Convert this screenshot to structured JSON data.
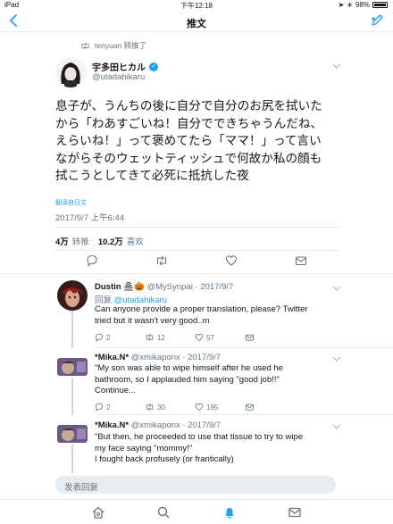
{
  "status_bar": {
    "carrier": "iPad",
    "time": "下午12:18",
    "battery": "98%"
  },
  "nav": {
    "title": "推文"
  },
  "retweet": {
    "text": "tenyuan 转推了"
  },
  "tweet": {
    "author_name": "宇多田ヒカル",
    "author_handle": "@utadahikaru",
    "lines": [
      "息子が、うんちの後に自分で自分のお尻を拭いた",
      "から「わあすごいね！自分でできちゃうんだね、",
      "えらいね！」って褒めてたら「ママ！」って言い",
      "ながらそのウェットティッシュで何故か私の顔も",
      "拭こうとしてきて必死に抵抗した夜"
    ],
    "translate_label": "翻译自日文",
    "timestamp": "2017/9/7 上午6:44",
    "retweets_count": "4万",
    "retweets_label": "转推",
    "likes_count": "10.2万",
    "likes_label": "喜欢"
  },
  "replies": [
    {
      "name": "Dustin",
      "handle_date": "@MySynpai · 2017/9/7",
      "reply_to_prefix": "回复",
      "reply_to": "@utadahikaru",
      "lines": [
        "Can anyone provide a proper translation, please? Twitter",
        "tried but it wasn't very good..m"
      ],
      "replies": "2",
      "retweets": "12",
      "likes": "57"
    },
    {
      "name": "*Mika.N*",
      "handle_date": "@xmikaponx · 2017/9/7",
      "lines": [
        "\"My son was able to wipe himself after he used he",
        "bathroom, so I applauded him saying \"good job!!\"",
        "Continue..."
      ],
      "replies": "2",
      "retweets": "30",
      "likes": "195"
    },
    {
      "name": "*Mika.N*",
      "handle_date": "@xmikaponx · 2017/9/7",
      "lines": [
        "\"But then, he proceeded to use that tissue to try to wipe",
        "my face saying \"mommy!\"",
        "I fought back profusely (or frantically)"
      ]
    }
  ],
  "composer": {
    "placeholder": "发表回复"
  },
  "colors": {
    "accent": "#1da1f2",
    "secondary_text": "#657786",
    "like_active": "#e0245e"
  },
  "icons": [
    "back-arrow-icon",
    "compose-icon",
    "retweet-icon",
    "verified-badge-icon",
    "chevron-down-icon",
    "reply-icon",
    "heart-icon",
    "message-icon",
    "home-icon",
    "search-icon",
    "notifications-icon",
    "mail-icon"
  ]
}
